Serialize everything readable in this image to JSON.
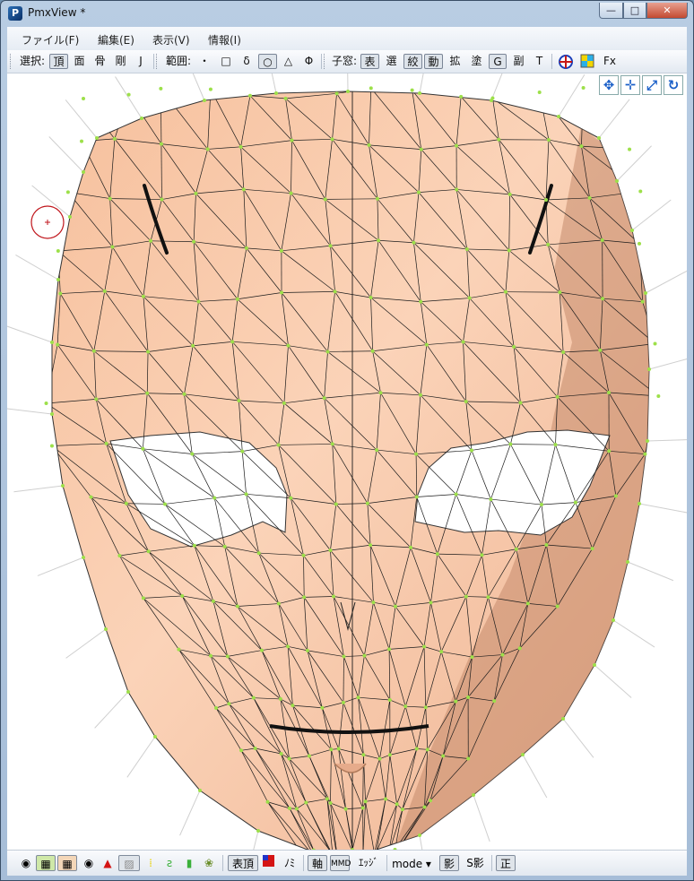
{
  "window": {
    "title": "PmxView *",
    "app_icon": "pmx-app-icon"
  },
  "titlebar_buttons": {
    "minimize": "—",
    "maximize": "□",
    "close": "✕"
  },
  "menu": [
    "ファイル(F)",
    "編集(E)",
    "表示(V)",
    "情報(I)"
  ],
  "toolbar": {
    "select_label": "選択:",
    "select_items": [
      "頂",
      "面",
      "骨",
      "剛",
      "J"
    ],
    "range_label": "範囲:",
    "range_items": [
      "・",
      "□",
      "δ",
      "○",
      "△",
      "Φ"
    ],
    "child_label": "子窓:",
    "child_items": [
      "表",
      "選",
      "絞",
      "動",
      "拡",
      "塗",
      "G",
      "副",
      "T"
    ],
    "fx_label": "Fx"
  },
  "nav_icons": [
    "move-xy-icon",
    "move-xz-icon",
    "zoom-icon",
    "rotate-icon"
  ],
  "statusbar": {
    "vertex_label": "表頂",
    "mi_label": "ﾉﾐ",
    "axis_label": "軸",
    "mmd_label": "MMD",
    "edge_label": "ｴｯｼﾞ",
    "mode_label": "mode",
    "shadow_label": "影",
    "sshadow_label": "S影",
    "front_label": "正"
  },
  "colors": {
    "skin": "#f4b995",
    "skin_light": "#fdd8bf",
    "skin_shadow": "#c58b6c",
    "wire": "#1b1b1b",
    "vertex": "#9de04a",
    "normal": "#cfcfcf",
    "cursor": "#c0161c",
    "accent": "#1a5fc8"
  }
}
